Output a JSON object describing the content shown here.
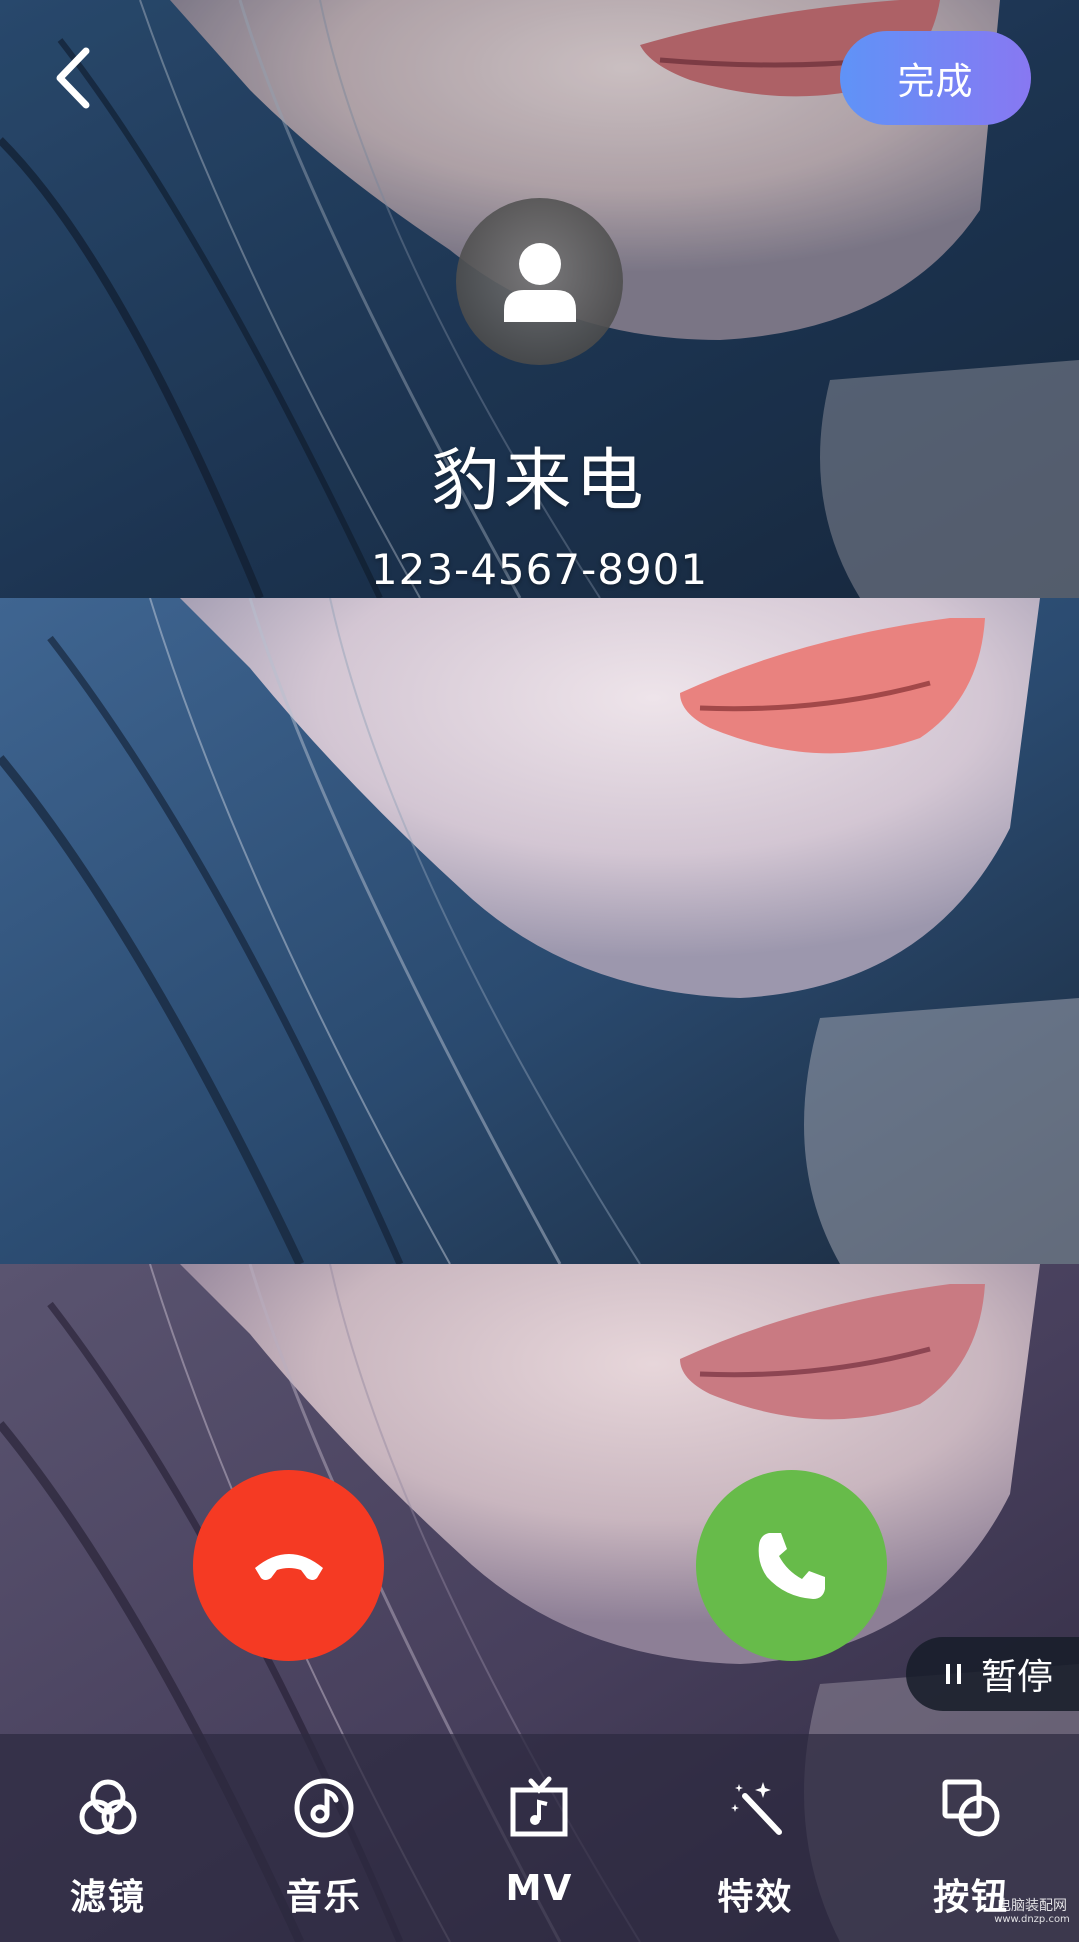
{
  "header": {
    "done_label": "完成"
  },
  "caller": {
    "name": "豹来电",
    "number": "123-4567-8901"
  },
  "pause": {
    "label": "暂停"
  },
  "toolbar": {
    "items": [
      {
        "label": "滤镜",
        "icon": "filter-icon"
      },
      {
        "label": "音乐",
        "icon": "music-icon"
      },
      {
        "label": "MV",
        "icon": "mv-icon"
      },
      {
        "label": "特效",
        "icon": "effects-icon"
      },
      {
        "label": "按钮",
        "icon": "buttons-icon"
      }
    ]
  },
  "watermark": {
    "cn": "电脑装配网",
    "url": "www.dnzp.com"
  },
  "colors": {
    "done_gradient_start": "#5f93f7",
    "done_gradient_end": "#8878f2",
    "decline": "#f53a23",
    "answer": "#67bb4a",
    "frame_1_tint": "#2f5275",
    "frame_2_tint": "#3a5d84",
    "frame_3_tint": "#6e5f7c"
  }
}
